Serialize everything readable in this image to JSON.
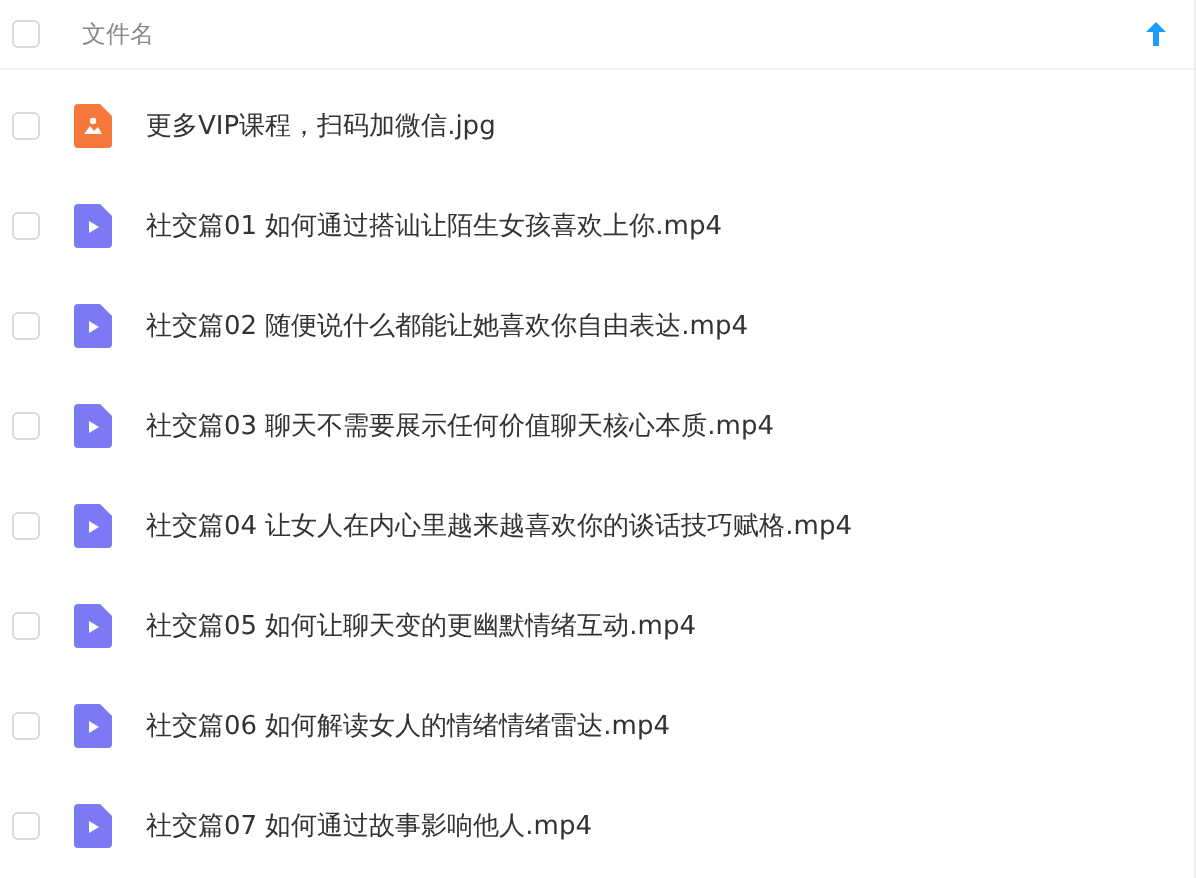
{
  "header": {
    "column": "文件名",
    "checked": false,
    "sort_ascending": true
  },
  "files": [
    {
      "name": "更多VIP课程，扫码加微信.jpg",
      "kind": "image",
      "checked": false
    },
    {
      "name": "社交篇01 如何通过搭讪让陌生女孩喜欢上你.mp4",
      "kind": "video",
      "checked": false
    },
    {
      "name": "社交篇02 随便说什么都能让她喜欢你自由表达.mp4",
      "kind": "video",
      "checked": false
    },
    {
      "name": "社交篇03 聊天不需要展示任何价值聊天核心本质.mp4",
      "kind": "video",
      "checked": false
    },
    {
      "name": "社交篇04 让女人在内心里越来越喜欢你的谈话技巧赋格.mp4",
      "kind": "video",
      "checked": false
    },
    {
      "name": "社交篇05 如何让聊天变的更幽默情绪互动.mp4",
      "kind": "video",
      "checked": false
    },
    {
      "name": "社交篇06 如何解读女人的情绪情绪雷达.mp4",
      "kind": "video",
      "checked": false
    },
    {
      "name": "社交篇07 如何通过故事影响他人.mp4",
      "kind": "video",
      "checked": false
    }
  ]
}
